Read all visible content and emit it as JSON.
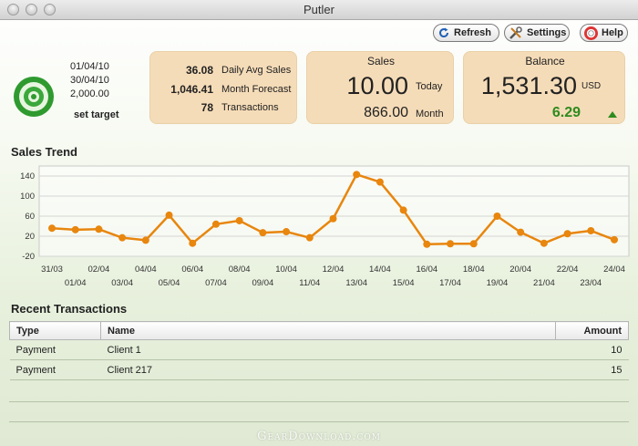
{
  "window": {
    "title": "Putler"
  },
  "toolbar": {
    "refresh_label": "Refresh",
    "settings_label": "Settings",
    "help_label": "Help"
  },
  "target": {
    "date_from": "01/04/10",
    "date_to": "30/04/10",
    "amount": "2,000.00",
    "set_target_label": "set target"
  },
  "stats": {
    "avg_value": "36.08",
    "avg_label": "Daily Avg Sales",
    "forecast_value": "1,046.41",
    "forecast_label": "Month Forecast",
    "tx_value": "78",
    "tx_label": "Transactions"
  },
  "sales": {
    "title": "Sales",
    "today_value": "10.00",
    "today_label": "Today",
    "month_value": "866.00",
    "month_label": "Month"
  },
  "balance": {
    "title": "Balance",
    "value": "1,531.30",
    "currency": "USD",
    "change": "6.29"
  },
  "chart_section_title": "Sales Trend",
  "chart_data": {
    "type": "line",
    "title": "Sales Trend",
    "ylim": [
      -20,
      160
    ],
    "yticks": [
      "140",
      "100",
      "60",
      "20",
      "-20"
    ],
    "ytick_values": [
      140,
      100,
      60,
      20,
      -20
    ],
    "x": [
      "31/03",
      "01/04",
      "02/04",
      "03/04",
      "04/04",
      "05/04",
      "06/04",
      "07/04",
      "08/04",
      "09/04",
      "10/04",
      "11/04",
      "12/04",
      "13/04",
      "14/04",
      "15/04",
      "16/04",
      "17/04",
      "18/04",
      "19/04",
      "20/04",
      "21/04",
      "22/04",
      "23/04",
      "24/04"
    ],
    "values": [
      36,
      33,
      34,
      17,
      12,
      62,
      6,
      44,
      51,
      27,
      29,
      17,
      55,
      143,
      128,
      72,
      4,
      5,
      5,
      60,
      28,
      6,
      25,
      31,
      13
    ],
    "grid": true,
    "color": "#e8860e"
  },
  "transactions": {
    "title": "Recent Transactions",
    "columns": [
      "Type",
      "Name",
      "Amount"
    ],
    "rows": [
      {
        "type": "Payment",
        "name": "Client 1",
        "amount": "10"
      },
      {
        "type": "Payment",
        "name": "Client 217",
        "amount": "15"
      }
    ]
  },
  "watermark": "GearDownload.com",
  "colors": {
    "card_bg": "#f5dcb8",
    "line": "#e8860e",
    "positive": "#2e8b1e",
    "target_green": "#3aa83a"
  }
}
